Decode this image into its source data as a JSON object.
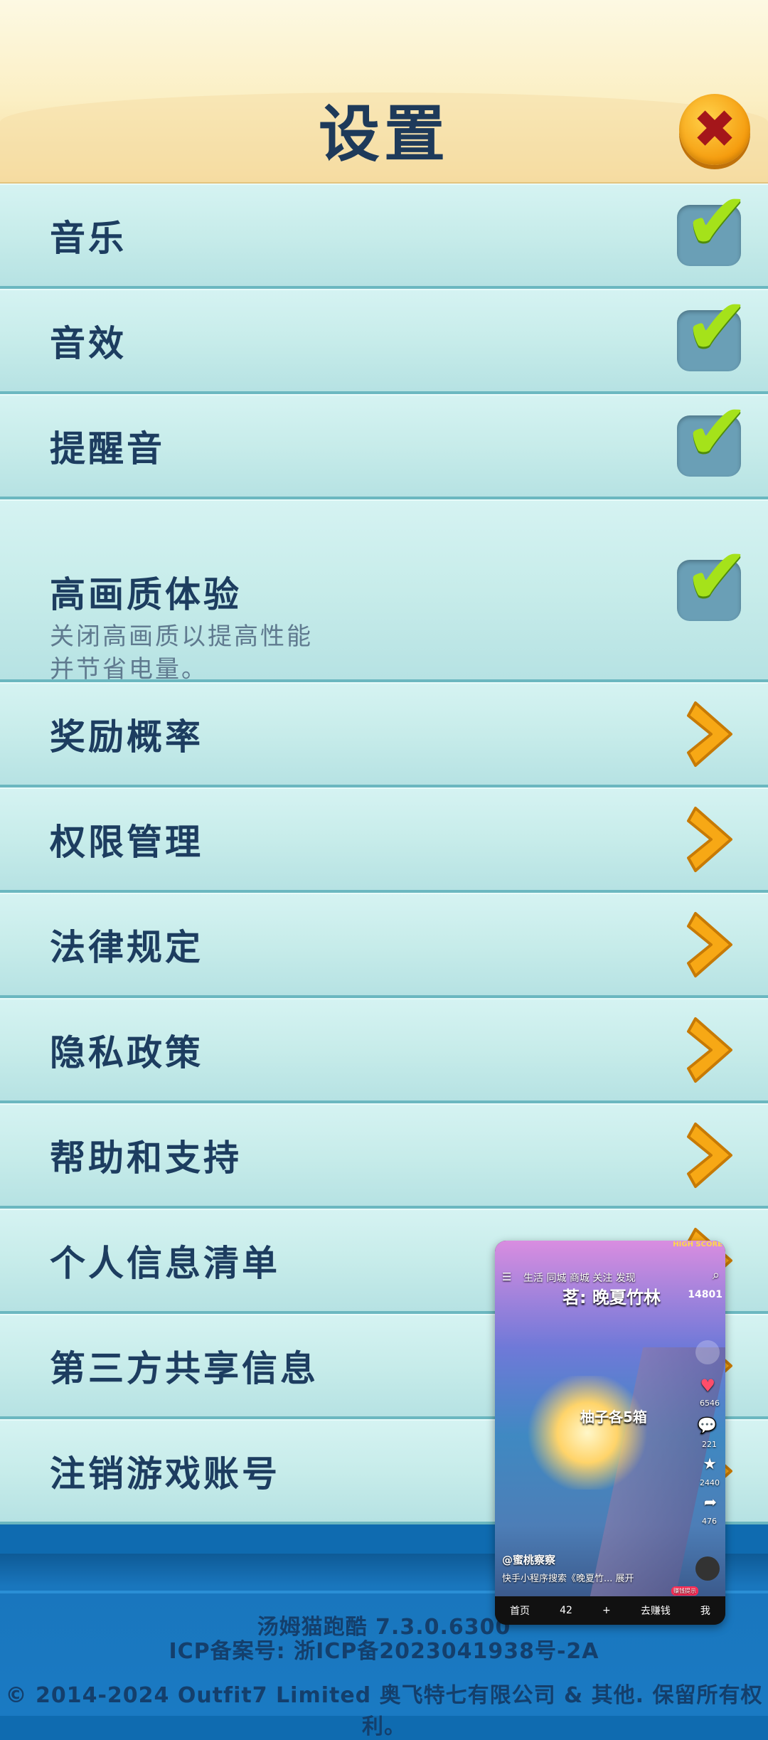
{
  "header": {
    "title": "设置",
    "close_icon": "close-x-icon"
  },
  "settings": {
    "toggles": [
      {
        "label": "音乐",
        "checked": true
      },
      {
        "label": "音效",
        "checked": true
      },
      {
        "label": "提醒音",
        "checked": true
      },
      {
        "label": "高画质体验",
        "sub_line1": "关闭高画质以提高性能",
        "sub_line2": "并节省电量。",
        "checked": true
      }
    ],
    "links": [
      {
        "label": "奖励概率"
      },
      {
        "label": "权限管理"
      },
      {
        "label": "法律规定"
      },
      {
        "label": "隐私政策"
      },
      {
        "label": "帮助和支持"
      },
      {
        "label": "个人信息清单"
      },
      {
        "label": "第三方共享信息"
      },
      {
        "label": "注销游戏账号"
      }
    ]
  },
  "footer": {
    "version": "汤姆猫跑酷 7.3.0.6300",
    "icp": "ICP备案号: 浙ICP备2023041938号-2A",
    "copyright": "© 2014-2024 Outfit7 Limited 奥飞特七有限公司 & 其他. 保留所有权利。"
  },
  "pip_video": {
    "tabs": "生活   同城   商城   关注   发现",
    "title_overlay": "茗: 晚夏竹林",
    "mid_overlay": "柚子各5箱",
    "author": "@蜜桃察察",
    "caption": "快手小程序搜索《晚夏竹... 展开",
    "high_score_label": "HIGH SCORE",
    "score": "14801",
    "likes": "6546",
    "comments": "221",
    "stars": "2440",
    "shares": "476",
    "nav": [
      "首页",
      "42",
      "+",
      "去赚钱",
      "我"
    ],
    "earn_badge": "赚钱提示"
  },
  "colors": {
    "row_bg": "#c7ecea",
    "label": "#1d3d60",
    "check": "#a5e21a",
    "chevron": "#f7a815",
    "footer": "#1a7ac3"
  }
}
